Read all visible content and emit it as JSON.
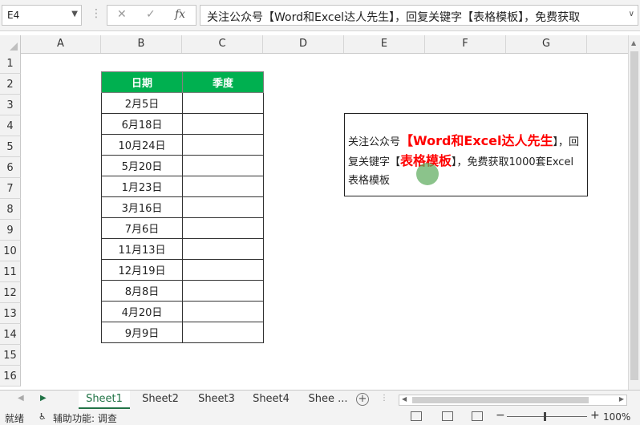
{
  "formula_bar": {
    "name_box": "E4",
    "cancel_icon": "✕",
    "enter_icon": "✓",
    "fx_icon": "fx",
    "content": "关注公众号【Word和Excel达人先生】，回复关键字【表格模板】，免费获取"
  },
  "columns": [
    "A",
    "B",
    "C",
    "D",
    "E",
    "F",
    "G"
  ],
  "rows": [
    "1",
    "2",
    "3",
    "4",
    "5",
    "6",
    "7",
    "8",
    "9",
    "10",
    "11",
    "12",
    "13",
    "14",
    "15",
    "16"
  ],
  "table": {
    "headers": [
      "日期",
      "季度"
    ],
    "dates": [
      "2月5日",
      "6月18日",
      "10月24日",
      "5月20日",
      "1月23日",
      "3月16日",
      "7月6日",
      "11月13日",
      "12月19日",
      "8月8日",
      "4月20日",
      "9月9日"
    ]
  },
  "textbox": {
    "part1": "关注公众号",
    "red1": "【Word和Excel达人先生",
    "part2": "】，回复关键字【",
    "red2": "表格模板",
    "part3": "】，免费获取1000套Excel表格模板"
  },
  "sheet_tabs": [
    "Sheet1",
    "Sheet2",
    "Sheet3",
    "Sheet4",
    "Shee ..."
  ],
  "status_bar": {
    "ready": "就绪",
    "accessibility": "辅助功能: 调查",
    "zoom": "100%"
  },
  "colors": {
    "header_green": "#00b050",
    "red_text": "#ff0000",
    "excel_green": "#217346"
  }
}
